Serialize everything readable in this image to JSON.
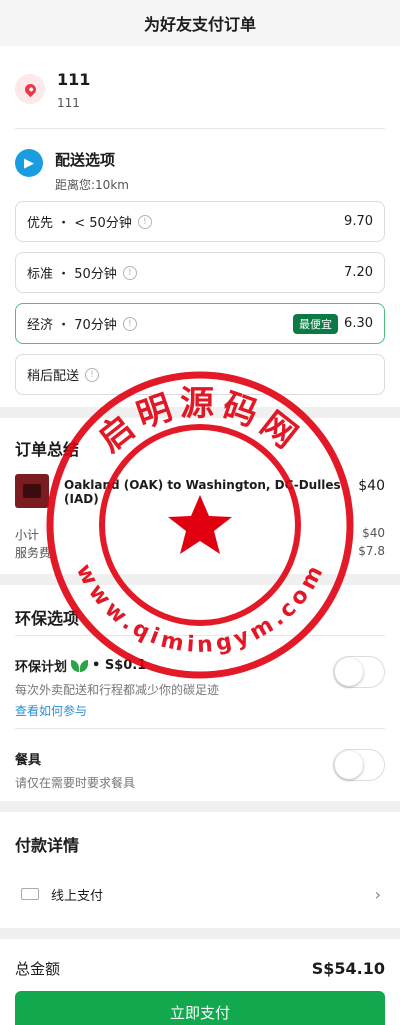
{
  "header": {
    "title": "为好友支付订单"
  },
  "address": {
    "title": "111",
    "subtitle": "111"
  },
  "delivery": {
    "title": "配送选项",
    "distance": "距离您:10km",
    "options": [
      {
        "label": "优先 ・ < 50分钟",
        "price": "9.70",
        "badge": ""
      },
      {
        "label": "标准 ・ 50分钟",
        "price": "7.20",
        "badge": ""
      },
      {
        "label": "经济 ・ 70分钟",
        "price": "6.30",
        "badge": "最便宜"
      },
      {
        "label": "稍后配送",
        "price": "",
        "badge": ""
      }
    ]
  },
  "summary": {
    "title": "订单总结",
    "item_name": "Oakland (OAK) to Washington, DC-Dulles (IAD)",
    "item_price": "$40",
    "subtotal_label": "小计",
    "subtotal_value": "$40",
    "fee_label": "服务费",
    "fee_value": "$7.8"
  },
  "eco": {
    "title": "环保选项",
    "plan_title": "环保计划",
    "plan_price": "• S$0.1",
    "plan_desc": "每次外卖配送和行程都减少你的碳足迹",
    "plan_link": "查看如何参与",
    "cutlery_title": "餐具",
    "cutlery_desc": "请仅在需要时要求餐具"
  },
  "payment": {
    "title": "付款详情",
    "method": "线上支付"
  },
  "footer": {
    "total_label": "总金额",
    "total_value": "S$54.10",
    "pay_button": "立即支付"
  },
  "watermark": {
    "text_top": "启明源码网",
    "text_bottom": "www.qimingym.com"
  },
  "colors": {
    "primary_green": "#11a84e",
    "badge_green": "#0b7a45",
    "watermark_red": "#e0000f"
  },
  "icons": [
    "location-pin-icon",
    "truck-icon",
    "info-icon",
    "leaf-icon",
    "card-icon",
    "chevron-right-icon"
  ]
}
